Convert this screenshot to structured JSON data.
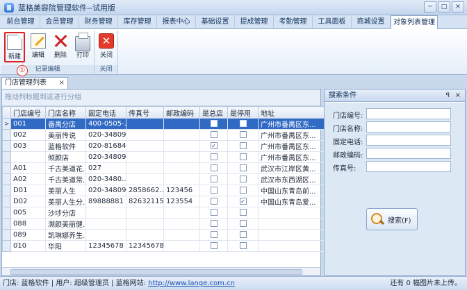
{
  "window": {
    "title": "蓝格美容院管理软件--试用版"
  },
  "menu": {
    "tabs": [
      "前台管理",
      "会员管理",
      "财务管理",
      "库存管理",
      "报表中心",
      "基础设置",
      "提成管理",
      "考勤管理",
      "工具面板",
      "商城设置",
      "对象列表管理"
    ],
    "active_index": 10
  },
  "ribbon": {
    "record_group": {
      "label": "记录编辑",
      "buttons": [
        {
          "label": "新建",
          "icon": "new-document-icon"
        },
        {
          "label": "编辑",
          "icon": "edit-icon"
        },
        {
          "label": "删除",
          "icon": "delete-x-icon"
        },
        {
          "label": "打印",
          "icon": "printer-icon"
        }
      ]
    },
    "close_group": {
      "label": "关闭",
      "button_label": "关闭",
      "icon": "close-red-icon"
    },
    "annotation": "①"
  },
  "doc_tab": {
    "label": "门店管理列表",
    "close": "×"
  },
  "grid": {
    "group_hint": "拖动列标题到这进行分组",
    "columns": [
      "门店编号",
      "门店名称",
      "固定电话",
      "传真号",
      "邮政编码",
      "是总店",
      "是停用",
      "地址"
    ],
    "rows": [
      {
        "indicator": ">",
        "cells": [
          "001",
          "番禺分店",
          "400-0505-...",
          "",
          "",
          "",
          "",
          "广州市番禺区东..."
        ],
        "is_hq": false,
        "disabled": false,
        "selected": true
      },
      {
        "indicator": "",
        "cells": [
          "002",
          "美丽传说",
          "020-34809...",
          "",
          "",
          "",
          "",
          "广州市番禺区东..."
        ],
        "is_hq": false,
        "disabled": false,
        "selected": false
      },
      {
        "indicator": "",
        "cells": [
          "003",
          "蓝格软件",
          "020-81684...",
          "",
          "",
          "",
          "",
          "广州市番禺区东..."
        ],
        "is_hq": true,
        "disabled": false,
        "selected": false
      },
      {
        "indicator": "",
        "cells": [
          "",
          "倾颜店",
          "020-34809...",
          "",
          "",
          "",
          "",
          "广州市番禺区东..."
        ],
        "is_hq": false,
        "disabled": false,
        "selected": false
      },
      {
        "indicator": "",
        "cells": [
          "A01",
          "千古美道花...",
          "027",
          "",
          "",
          "",
          "",
          "武汉市江岸区黄..."
        ],
        "is_hq": false,
        "disabled": false,
        "selected": false
      },
      {
        "indicator": "",
        "cells": [
          "A02",
          "千古美道常...",
          " 020-3480...",
          "",
          "",
          "",
          "",
          "武汉市东西湖区..."
        ],
        "is_hq": false,
        "disabled": false,
        "selected": false
      },
      {
        "indicator": "",
        "cells": [
          "D01",
          "美丽人生",
          "020-34809...",
          "2858662...",
          "123456",
          "",
          "",
          "中国山东青岛前..."
        ],
        "is_hq": false,
        "disabled": false,
        "selected": false
      },
      {
        "indicator": "",
        "cells": [
          "D02",
          "美丽人生分...",
          "89888881",
          "826321151",
          "123554",
          "",
          "",
          "中国山东青岛爱..."
        ],
        "is_hq": false,
        "disabled": true,
        "selected": false
      },
      {
        "indicator": "",
        "cells": [
          "005",
          "沙埗分店",
          "",
          "",
          "",
          "",
          "",
          ""
        ],
        "is_hq": false,
        "disabled": false,
        "selected": false
      },
      {
        "indicator": "",
        "cells": [
          "088",
          "溯颜美丽健...",
          "",
          "",
          "",
          "",
          "",
          ""
        ],
        "is_hq": false,
        "disabled": false,
        "selected": false
      },
      {
        "indicator": "",
        "cells": [
          "089",
          "凯琳娜养生...",
          "",
          "",
          "",
          "",
          "",
          ""
        ],
        "is_hq": false,
        "disabled": false,
        "selected": false
      },
      {
        "indicator": "",
        "cells": [
          "010",
          "华阳",
          "12345678",
          "12345678",
          "",
          "",
          "",
          ""
        ],
        "is_hq": false,
        "disabled": false,
        "selected": false
      }
    ]
  },
  "search_panel": {
    "title": "搜索条件",
    "pin": "ꟼ",
    "close": "×",
    "fields": [
      {
        "label": "门店编号:",
        "value": ""
      },
      {
        "label": "门店名称:",
        "value": ""
      },
      {
        "label": "固定电话:",
        "value": ""
      },
      {
        "label": "邮政编码:",
        "value": ""
      },
      {
        "label": "传真号:",
        "value": ""
      }
    ],
    "button_label": "搜索(F)"
  },
  "status": {
    "store_label": "门店: 蓝格软件",
    "user_label": "用户: 超级管理员",
    "site_label": "蓝格网站:",
    "site_url": "http://www.lange.com.cn",
    "right_text": "还有 0 幅图片未上传。"
  },
  "colors": {
    "selection": "#316ac5",
    "accent_red": "#e02020"
  }
}
